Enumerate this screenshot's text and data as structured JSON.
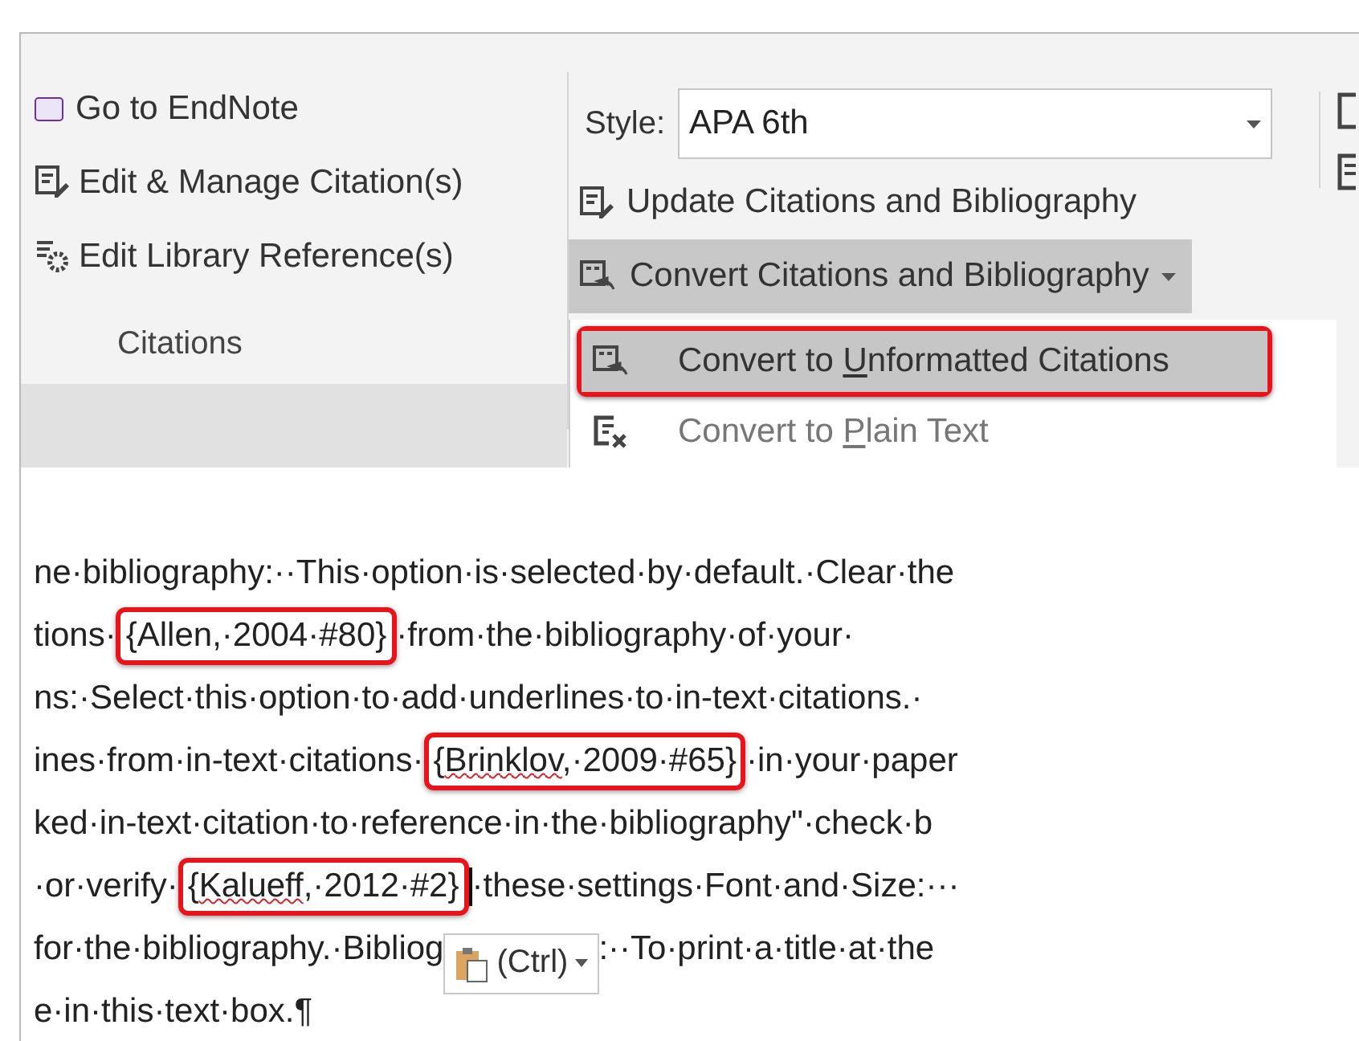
{
  "ribbon": {
    "citations_group": {
      "items": [
        {
          "kind": "endnote",
          "label": "Go to EndNote"
        },
        {
          "kind": "edit",
          "label": "Edit & Manage Citation(s)"
        },
        {
          "kind": "library",
          "label": "Edit Library Reference(s)"
        }
      ],
      "label": "Citations"
    },
    "bibliography_group": {
      "style_label": "Style:",
      "style_value": "APA 6th",
      "buttons": [
        {
          "kind": "update",
          "label": "Update Citations and Bibliography",
          "expanded": false
        },
        {
          "kind": "convert",
          "label": "Convert Citations and Bibliography",
          "expanded": true
        }
      ],
      "menu": [
        {
          "kind": "convert",
          "parts": [
            "Convert to ",
            "U",
            "nformatted Citations"
          ],
          "selected": true
        },
        {
          "kind": "plain",
          "parts": [
            "Convert to ",
            "P",
            "lain Text"
          ],
          "selected": false
        }
      ]
    }
  },
  "document": {
    "lines": [
      {
        "segments": [
          {
            "kind": "text",
            "text": "ne·bibliography:··This·option·is·selected·by·default.·Clear·the"
          }
        ]
      },
      {
        "segments": [
          {
            "kind": "text",
            "text": "tions·"
          },
          {
            "kind": "citation",
            "parts": [
              {
                "text": "{Allen,·2004·#80}",
                "misspelled": false
              }
            ]
          },
          {
            "kind": "text",
            "text": "·from·the·bibliography·of·your·"
          }
        ]
      },
      {
        "segments": [
          {
            "kind": "text",
            "text": "ns:·Select·this·option·to·add·underlines·to·in-text·citations.·"
          }
        ]
      },
      {
        "segments": [
          {
            "kind": "text",
            "text": "ines·from·in-text·citations·"
          },
          {
            "kind": "citation",
            "parts": [
              {
                "text": "{",
                "misspelled": false
              },
              {
                "text": "Brinklov",
                "misspelled": true
              },
              {
                "text": ",·2009·#65}",
                "misspelled": false
              }
            ]
          },
          {
            "kind": "text",
            "text": "·in·your·paper"
          }
        ]
      },
      {
        "segments": [
          {
            "kind": "text",
            "text": "ked·in-text·citation·to·reference·in·the·bibliography\"·check·b"
          }
        ]
      },
      {
        "segments": [
          {
            "kind": "text",
            "text": "·or·verify·"
          },
          {
            "kind": "citation",
            "parts": [
              {
                "text": "{",
                "misspelled": false
              },
              {
                "text": "Kalueff",
                "misspelled": true
              },
              {
                "text": ",·2012·#2}",
                "misspelled": false
              }
            ]
          },
          {
            "kind": "caret"
          },
          {
            "kind": "text",
            "text": "·these·settings·Font·and·Size:···"
          }
        ]
      },
      {
        "segments": [
          {
            "kind": "text",
            "text": "for·the·bibliography.·Bibliog"
          },
          {
            "kind": "paste",
            "label": "(Ctrl)"
          },
          {
            "kind": "text",
            "text": ":··To·print·a·title·at·the"
          }
        ]
      },
      {
        "segments": [
          {
            "kind": "text",
            "text": "e·in·this·text·box.¶"
          }
        ]
      }
    ]
  }
}
